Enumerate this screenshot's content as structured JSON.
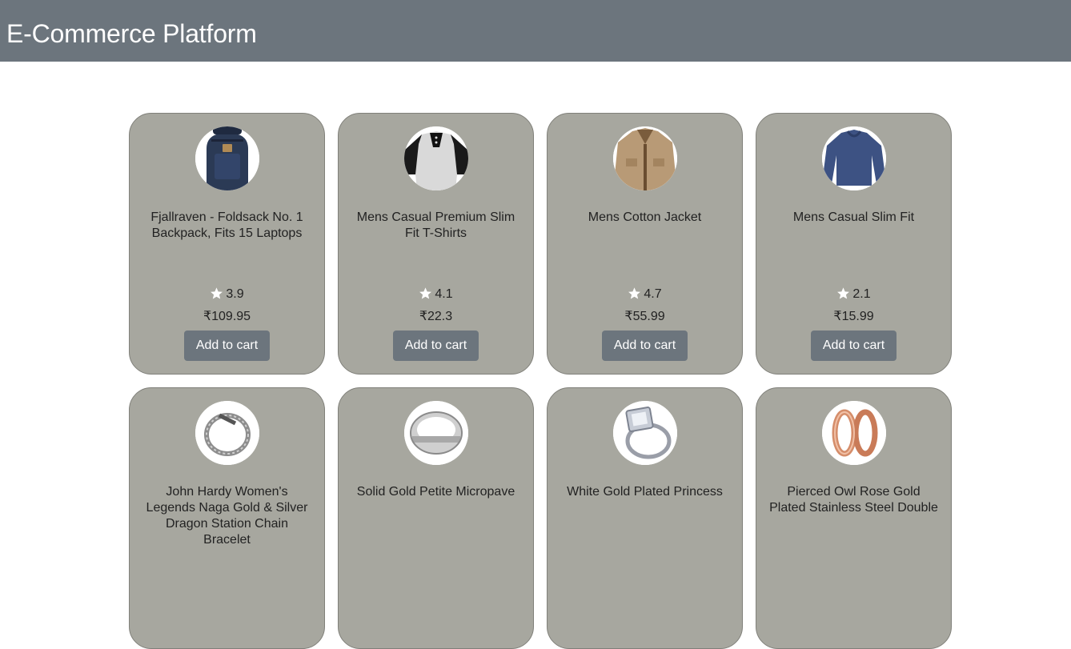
{
  "header": {
    "title": "E-Commerce Platform"
  },
  "products": [
    {
      "title": "Fjallraven - Foldsack No. 1 Backpack, Fits 15 Laptops",
      "rating": "3.9",
      "price": "₹109.95",
      "button": "Add to cart",
      "image_icon": "backpack-icon"
    },
    {
      "title": "Mens Casual Premium Slim Fit T-Shirts",
      "rating": "4.1",
      "price": "₹22.3",
      "button": "Add to cart",
      "image_icon": "raglan-shirt-icon"
    },
    {
      "title": "Mens Cotton Jacket",
      "rating": "4.7",
      "price": "₹55.99",
      "button": "Add to cart",
      "image_icon": "jacket-icon"
    },
    {
      "title": "Mens Casual Slim Fit",
      "rating": "2.1",
      "price": "₹15.99",
      "button": "Add to cart",
      "image_icon": "long-sleeve-shirt-icon"
    },
    {
      "title": "John Hardy Women's Legends Naga Gold & Silver Dragon Station Chain Bracelet",
      "image_icon": "bracelet-icon"
    },
    {
      "title": "Solid Gold Petite Micropave",
      "image_icon": "ring-icon"
    },
    {
      "title": "White Gold Plated Princess",
      "image_icon": "diamond-ring-icon"
    },
    {
      "title": "Pierced Owl Rose Gold Plated Stainless Steel Double",
      "image_icon": "rose-gold-rings-icon"
    }
  ],
  "colors": {
    "header_bg": "#6c757d",
    "card_bg": "#a7a79f",
    "button_bg": "#6c757d"
  }
}
